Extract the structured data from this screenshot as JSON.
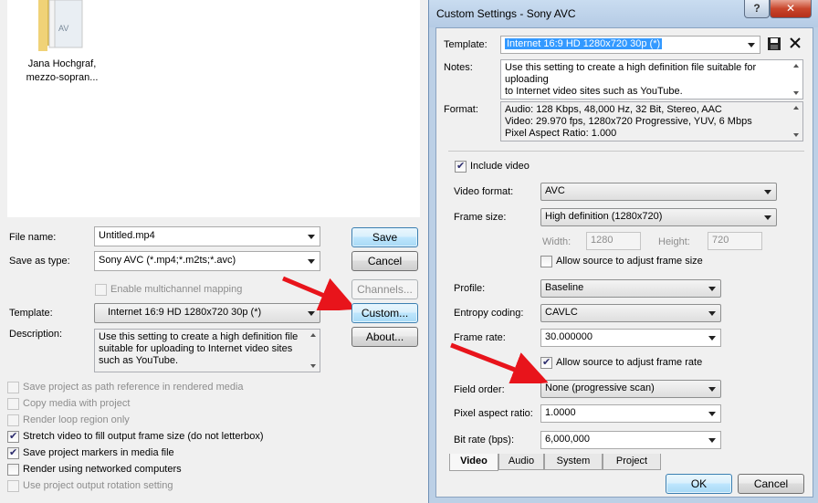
{
  "left": {
    "folder": {
      "label_line1": "Jana Hochgraf,",
      "label_line2": "mezzo-sopran...",
      "badge": "AV"
    },
    "file_name": {
      "label": "File name:",
      "value": "Untitled.mp4"
    },
    "save_as_type": {
      "label": "Save as type:",
      "value": "Sony AVC (*.mp4;*.m2ts;*.avc)"
    },
    "multichannel": {
      "label": "Enable multichannel mapping"
    },
    "template": {
      "label": "Template:",
      "value": "Internet 16:9 HD 1280x720 30p (*)"
    },
    "description": {
      "label": "Description:",
      "line1": "Use this setting to create a high definition file",
      "line2": "suitable for uploading to Internet video sites",
      "line3": "such as YouTube."
    },
    "buttons": {
      "save": "Save",
      "cancel": "Cancel",
      "channels": "Channels...",
      "custom": "Custom...",
      "about": "About..."
    },
    "options": [
      {
        "label": "Save project as path reference in rendered media",
        "checked": false,
        "enabled": false
      },
      {
        "label": "Copy media with project",
        "checked": false,
        "enabled": false
      },
      {
        "label": "Render loop region only",
        "checked": false,
        "enabled": false
      },
      {
        "label": "Stretch video to fill output frame size (do not letterbox)",
        "checked": true,
        "enabled": true
      },
      {
        "label": "Save project markers in media file",
        "checked": true,
        "enabled": true
      },
      {
        "label": "Render using networked computers",
        "checked": false,
        "enabled": true
      },
      {
        "label": "Use project output rotation setting",
        "checked": false,
        "enabled": false
      }
    ]
  },
  "right": {
    "title": "Custom Settings - Sony AVC",
    "help_glyph": "?",
    "close_glyph": "✕",
    "template": {
      "label": "Template:",
      "value": "Internet 16:9 HD 1280x720 30p (*)"
    },
    "notes": {
      "label": "Notes:",
      "line1": "Use this setting to create a high definition file suitable for uploading",
      "line2": "to Internet video sites such as YouTube."
    },
    "format": {
      "label": "Format:",
      "line1": "Audio: 128 Kbps, 48,000 Hz, 32 Bit, Stereo, AAC",
      "line2": "Video: 29.970 fps, 1280x720 Progressive, YUV, 6 Mbps",
      "line3": "Pixel Aspect Ratio: 1.000"
    },
    "include_video": {
      "label": "Include video",
      "checked": true
    },
    "video_format": {
      "label": "Video format:",
      "value": "AVC"
    },
    "frame_size": {
      "label": "Frame size:",
      "value": "High definition (1280x720)"
    },
    "width": {
      "label": "Width:",
      "value": "1280"
    },
    "height": {
      "label": "Height:",
      "value": "720"
    },
    "allow_frame_size": {
      "label": "Allow source to adjust frame size",
      "checked": false
    },
    "profile": {
      "label": "Profile:",
      "value": "Baseline"
    },
    "entropy": {
      "label": "Entropy coding:",
      "value": "CAVLC"
    },
    "frame_rate": {
      "label": "Frame rate:",
      "value": "30.000000"
    },
    "allow_frame_rate": {
      "label": "Allow source to adjust frame rate",
      "checked": true
    },
    "field_order": {
      "label": "Field order:",
      "value": "None (progressive scan)"
    },
    "pixel_aspect": {
      "label": "Pixel aspect ratio:",
      "value": "1.0000"
    },
    "bit_rate": {
      "label": "Bit rate (bps):",
      "value": "6,000,000"
    },
    "tabs": [
      "Video",
      "Audio",
      "System",
      "Project"
    ],
    "buttons": {
      "ok": "OK",
      "cancel": "Cancel"
    }
  }
}
